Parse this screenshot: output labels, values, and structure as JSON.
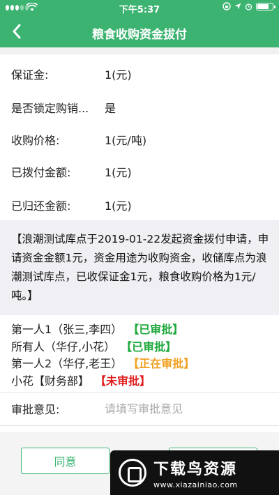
{
  "status_bar": {
    "time": "下午5:37",
    "battery_level": 0.8
  },
  "nav": {
    "back_icon": "chevron-left-icon",
    "title": "粮食收购资金拔付"
  },
  "info": [
    {
      "label": "保证金:",
      "value": "1(元)"
    },
    {
      "label": "是否锁定购销...",
      "value": "是"
    },
    {
      "label": "收购价格:",
      "value": "1(元/吨)"
    },
    {
      "label": "已拨付金额:",
      "value": "1(元)"
    },
    {
      "label": "已归还金额:",
      "value": "1(元)"
    }
  ],
  "description": "【浪潮测试库点于2019-01-22发起资金拨付申请，申请资金金额1元，资金用途为收购资金，收储库点为浪潮测试库点，已收保证金1元，粮食收购价格为1元/吨。】",
  "approvers": [
    {
      "name": "第一人1（张三,李四）",
      "status": "【已审批】",
      "status_color": "#1ea83c"
    },
    {
      "name": "所有人（华仔,小花）",
      "status": "【已审批】",
      "status_color": "#1ea83c"
    },
    {
      "name": "第一人2（华仔,老王）",
      "status": "【正在审批】",
      "status_color": "#f0a020"
    },
    {
      "name": "小花【财务部】",
      "status": "【未审批】",
      "status_color": "#e02020"
    }
  ],
  "opinion": {
    "label": "审批意见:",
    "placeholder": "请填写审批意见"
  },
  "buttons": {
    "agree": "同意",
    "second": ""
  },
  "watermark": {
    "cn": "下载鸟资源",
    "url": "www.xiazainiao.com"
  },
  "colors": {
    "brand": "#3cb371"
  }
}
